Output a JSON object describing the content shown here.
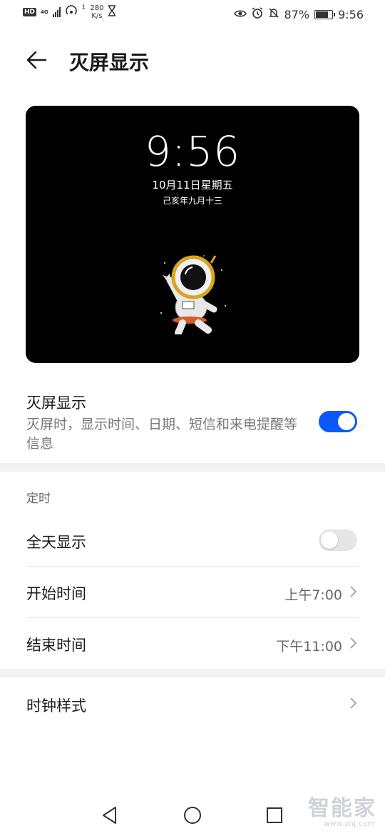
{
  "status_bar": {
    "hd": "HD",
    "network": "4G",
    "hotspot_count": "1",
    "speed_value": "280",
    "speed_unit": "K/s",
    "battery": "87%",
    "battery_level": 0.87,
    "time": "9:56"
  },
  "header": {
    "title": "灭屏显示"
  },
  "preview": {
    "time": "9:56",
    "date": "10月11日星期五",
    "lunar": "己亥年九月十三"
  },
  "aod": {
    "title": "灭屏显示",
    "subtitle": "灭屏时，显示时间、日期、短信和来电提醒等信息",
    "enabled": true
  },
  "schedule": {
    "section_label": "定时",
    "all_day_label": "全天显示",
    "all_day_enabled": false,
    "start_label": "开始时间",
    "start_value": "上午7:00",
    "end_label": "结束时间",
    "end_value": "下午11:00"
  },
  "clock_style": {
    "label": "时钟样式"
  },
  "watermark": {
    "text": "智能家",
    "url": "www.znj.com"
  },
  "colors": {
    "accent": "#0a59f7",
    "toggle_off": "#e6e6e6",
    "preview_bg": "#000000"
  }
}
